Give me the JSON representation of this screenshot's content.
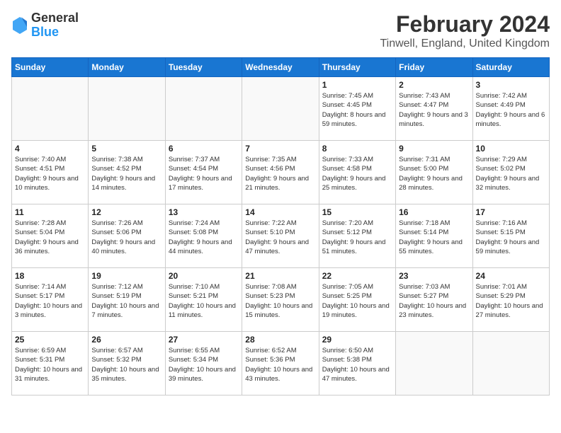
{
  "logo": {
    "general": "General",
    "blue": "Blue"
  },
  "header": {
    "month": "February 2024",
    "location": "Tinwell, England, United Kingdom"
  },
  "weekdays": [
    "Sunday",
    "Monday",
    "Tuesday",
    "Wednesday",
    "Thursday",
    "Friday",
    "Saturday"
  ],
  "weeks": [
    [
      {
        "day": "",
        "sunrise": "",
        "sunset": "",
        "daylight": "",
        "empty": true
      },
      {
        "day": "",
        "sunrise": "",
        "sunset": "",
        "daylight": "",
        "empty": true
      },
      {
        "day": "",
        "sunrise": "",
        "sunset": "",
        "daylight": "",
        "empty": true
      },
      {
        "day": "",
        "sunrise": "",
        "sunset": "",
        "daylight": "",
        "empty": true
      },
      {
        "day": "1",
        "sunrise": "Sunrise: 7:45 AM",
        "sunset": "Sunset: 4:45 PM",
        "daylight": "Daylight: 8 hours and 59 minutes."
      },
      {
        "day": "2",
        "sunrise": "Sunrise: 7:43 AM",
        "sunset": "Sunset: 4:47 PM",
        "daylight": "Daylight: 9 hours and 3 minutes."
      },
      {
        "day": "3",
        "sunrise": "Sunrise: 7:42 AM",
        "sunset": "Sunset: 4:49 PM",
        "daylight": "Daylight: 9 hours and 6 minutes."
      }
    ],
    [
      {
        "day": "4",
        "sunrise": "Sunrise: 7:40 AM",
        "sunset": "Sunset: 4:51 PM",
        "daylight": "Daylight: 9 hours and 10 minutes."
      },
      {
        "day": "5",
        "sunrise": "Sunrise: 7:38 AM",
        "sunset": "Sunset: 4:52 PM",
        "daylight": "Daylight: 9 hours and 14 minutes."
      },
      {
        "day": "6",
        "sunrise": "Sunrise: 7:37 AM",
        "sunset": "Sunset: 4:54 PM",
        "daylight": "Daylight: 9 hours and 17 minutes."
      },
      {
        "day": "7",
        "sunrise": "Sunrise: 7:35 AM",
        "sunset": "Sunset: 4:56 PM",
        "daylight": "Daylight: 9 hours and 21 minutes."
      },
      {
        "day": "8",
        "sunrise": "Sunrise: 7:33 AM",
        "sunset": "Sunset: 4:58 PM",
        "daylight": "Daylight: 9 hours and 25 minutes."
      },
      {
        "day": "9",
        "sunrise": "Sunrise: 7:31 AM",
        "sunset": "Sunset: 5:00 PM",
        "daylight": "Daylight: 9 hours and 28 minutes."
      },
      {
        "day": "10",
        "sunrise": "Sunrise: 7:29 AM",
        "sunset": "Sunset: 5:02 PM",
        "daylight": "Daylight: 9 hours and 32 minutes."
      }
    ],
    [
      {
        "day": "11",
        "sunrise": "Sunrise: 7:28 AM",
        "sunset": "Sunset: 5:04 PM",
        "daylight": "Daylight: 9 hours and 36 minutes."
      },
      {
        "day": "12",
        "sunrise": "Sunrise: 7:26 AM",
        "sunset": "Sunset: 5:06 PM",
        "daylight": "Daylight: 9 hours and 40 minutes."
      },
      {
        "day": "13",
        "sunrise": "Sunrise: 7:24 AM",
        "sunset": "Sunset: 5:08 PM",
        "daylight": "Daylight: 9 hours and 44 minutes."
      },
      {
        "day": "14",
        "sunrise": "Sunrise: 7:22 AM",
        "sunset": "Sunset: 5:10 PM",
        "daylight": "Daylight: 9 hours and 47 minutes."
      },
      {
        "day": "15",
        "sunrise": "Sunrise: 7:20 AM",
        "sunset": "Sunset: 5:12 PM",
        "daylight": "Daylight: 9 hours and 51 minutes."
      },
      {
        "day": "16",
        "sunrise": "Sunrise: 7:18 AM",
        "sunset": "Sunset: 5:14 PM",
        "daylight": "Daylight: 9 hours and 55 minutes."
      },
      {
        "day": "17",
        "sunrise": "Sunrise: 7:16 AM",
        "sunset": "Sunset: 5:15 PM",
        "daylight": "Daylight: 9 hours and 59 minutes."
      }
    ],
    [
      {
        "day": "18",
        "sunrise": "Sunrise: 7:14 AM",
        "sunset": "Sunset: 5:17 PM",
        "daylight": "Daylight: 10 hours and 3 minutes."
      },
      {
        "day": "19",
        "sunrise": "Sunrise: 7:12 AM",
        "sunset": "Sunset: 5:19 PM",
        "daylight": "Daylight: 10 hours and 7 minutes."
      },
      {
        "day": "20",
        "sunrise": "Sunrise: 7:10 AM",
        "sunset": "Sunset: 5:21 PM",
        "daylight": "Daylight: 10 hours and 11 minutes."
      },
      {
        "day": "21",
        "sunrise": "Sunrise: 7:08 AM",
        "sunset": "Sunset: 5:23 PM",
        "daylight": "Daylight: 10 hours and 15 minutes."
      },
      {
        "day": "22",
        "sunrise": "Sunrise: 7:05 AM",
        "sunset": "Sunset: 5:25 PM",
        "daylight": "Daylight: 10 hours and 19 minutes."
      },
      {
        "day": "23",
        "sunrise": "Sunrise: 7:03 AM",
        "sunset": "Sunset: 5:27 PM",
        "daylight": "Daylight: 10 hours and 23 minutes."
      },
      {
        "day": "24",
        "sunrise": "Sunrise: 7:01 AM",
        "sunset": "Sunset: 5:29 PM",
        "daylight": "Daylight: 10 hours and 27 minutes."
      }
    ],
    [
      {
        "day": "25",
        "sunrise": "Sunrise: 6:59 AM",
        "sunset": "Sunset: 5:31 PM",
        "daylight": "Daylight: 10 hours and 31 minutes."
      },
      {
        "day": "26",
        "sunrise": "Sunrise: 6:57 AM",
        "sunset": "Sunset: 5:32 PM",
        "daylight": "Daylight: 10 hours and 35 minutes."
      },
      {
        "day": "27",
        "sunrise": "Sunrise: 6:55 AM",
        "sunset": "Sunset: 5:34 PM",
        "daylight": "Daylight: 10 hours and 39 minutes."
      },
      {
        "day": "28",
        "sunrise": "Sunrise: 6:52 AM",
        "sunset": "Sunset: 5:36 PM",
        "daylight": "Daylight: 10 hours and 43 minutes."
      },
      {
        "day": "29",
        "sunrise": "Sunrise: 6:50 AM",
        "sunset": "Sunset: 5:38 PM",
        "daylight": "Daylight: 10 hours and 47 minutes."
      },
      {
        "day": "",
        "sunrise": "",
        "sunset": "",
        "daylight": "",
        "empty": true
      },
      {
        "day": "",
        "sunrise": "",
        "sunset": "",
        "daylight": "",
        "empty": true
      }
    ]
  ]
}
